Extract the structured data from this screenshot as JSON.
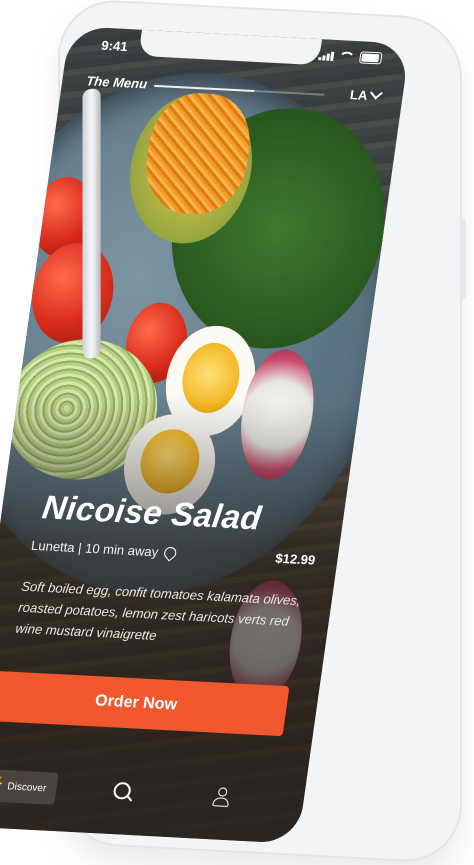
{
  "status": {
    "time": "9:41"
  },
  "header": {
    "title": "The Menu",
    "city": "LA"
  },
  "dish": {
    "name": "Nicoise Salad",
    "meta": "Lunetta | 10 min away",
    "price": "$12.99",
    "description": "Soft boiled egg, confit tomatoes kalamata olives, roasted potatoes, lemon zest haricots verts red wine mustard vinaigrette"
  },
  "actions": {
    "order_label": "Order Now"
  },
  "tabbar": {
    "discover_label": "Discover"
  },
  "colors": {
    "accent": "#f2582e"
  }
}
